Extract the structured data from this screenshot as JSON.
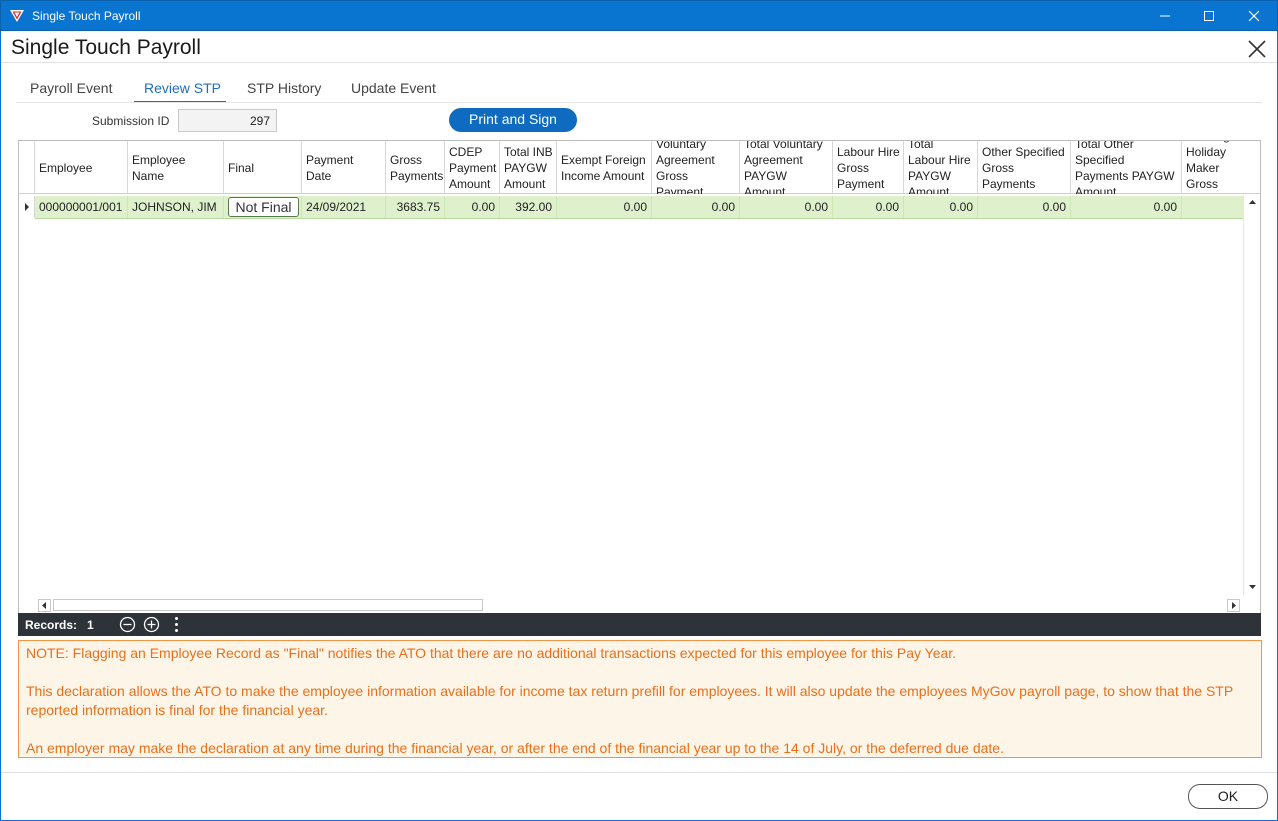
{
  "window": {
    "title": "Single Touch Payroll"
  },
  "dialog": {
    "title": "Single Touch Payroll"
  },
  "tabs": [
    {
      "label": "Payroll Event"
    },
    {
      "label": "Review STP"
    },
    {
      "label": "STP History"
    },
    {
      "label": "Update Event"
    }
  ],
  "active_tab": "Review STP",
  "submission": {
    "label": "Submission ID",
    "value": "297"
  },
  "print_button": {
    "label": "Print and Sign"
  },
  "grid": {
    "columns": [
      "Employee",
      "Employee Name",
      "Final",
      "Payment Date",
      "Gross Payments",
      "CDEP Payment Amount",
      "Total INB PAYGW Amount",
      "Exempt Foreign Income Amount",
      "Voluntary Agreement Gross Payment",
      "Total Voluntary Agreement PAYGW Amount",
      "Labour Hire Gross Payment",
      "Total Labour Hire PAYGW Amount",
      "Other Specified Gross Payments",
      "Total Other Specified Payments PAYGW Amount",
      "Working Holiday Maker Gross Payments"
    ],
    "rows": [
      {
        "employee": "000000001/001",
        "name": "JOHNSON, JIM",
        "final": "Not Final",
        "payment_date": "24/09/2021",
        "gross": "3683.75",
        "cdep": "0.00",
        "inb_paygw": "392.00",
        "exempt_foreign": "0.00",
        "vol_gross": "0.00",
        "vol_paygw": "0.00",
        "labour_gross": "0.00",
        "labour_paygw": "0.00",
        "other_gross": "0.00",
        "other_paygw": "0.00"
      }
    ]
  },
  "status": {
    "records_label": "Records:",
    "records_count": "1"
  },
  "note": {
    "p1": "NOTE: Flagging an Employee Record as \"Final\" notifies the ATO that there are no additional transactions expected for this employee for this Pay Year.",
    "p2": "This declaration allows the ATO to make the employee information available for income tax return prefill for employees. It will also update the employees MyGov payroll page, to show that the STP reported information is final for the financial year.",
    "p3": "An employer may make the declaration at any time during the financial year, or after the end of the financial year up to the 14 of July, or the deferred due date."
  },
  "ok_button": {
    "label": "OK"
  },
  "colors": {
    "titlebar": "#0a75d1",
    "accent": "#1b6ec2",
    "row_highlight": "#dff1cc",
    "note_text": "#e8701a",
    "note_border": "#f29443"
  }
}
